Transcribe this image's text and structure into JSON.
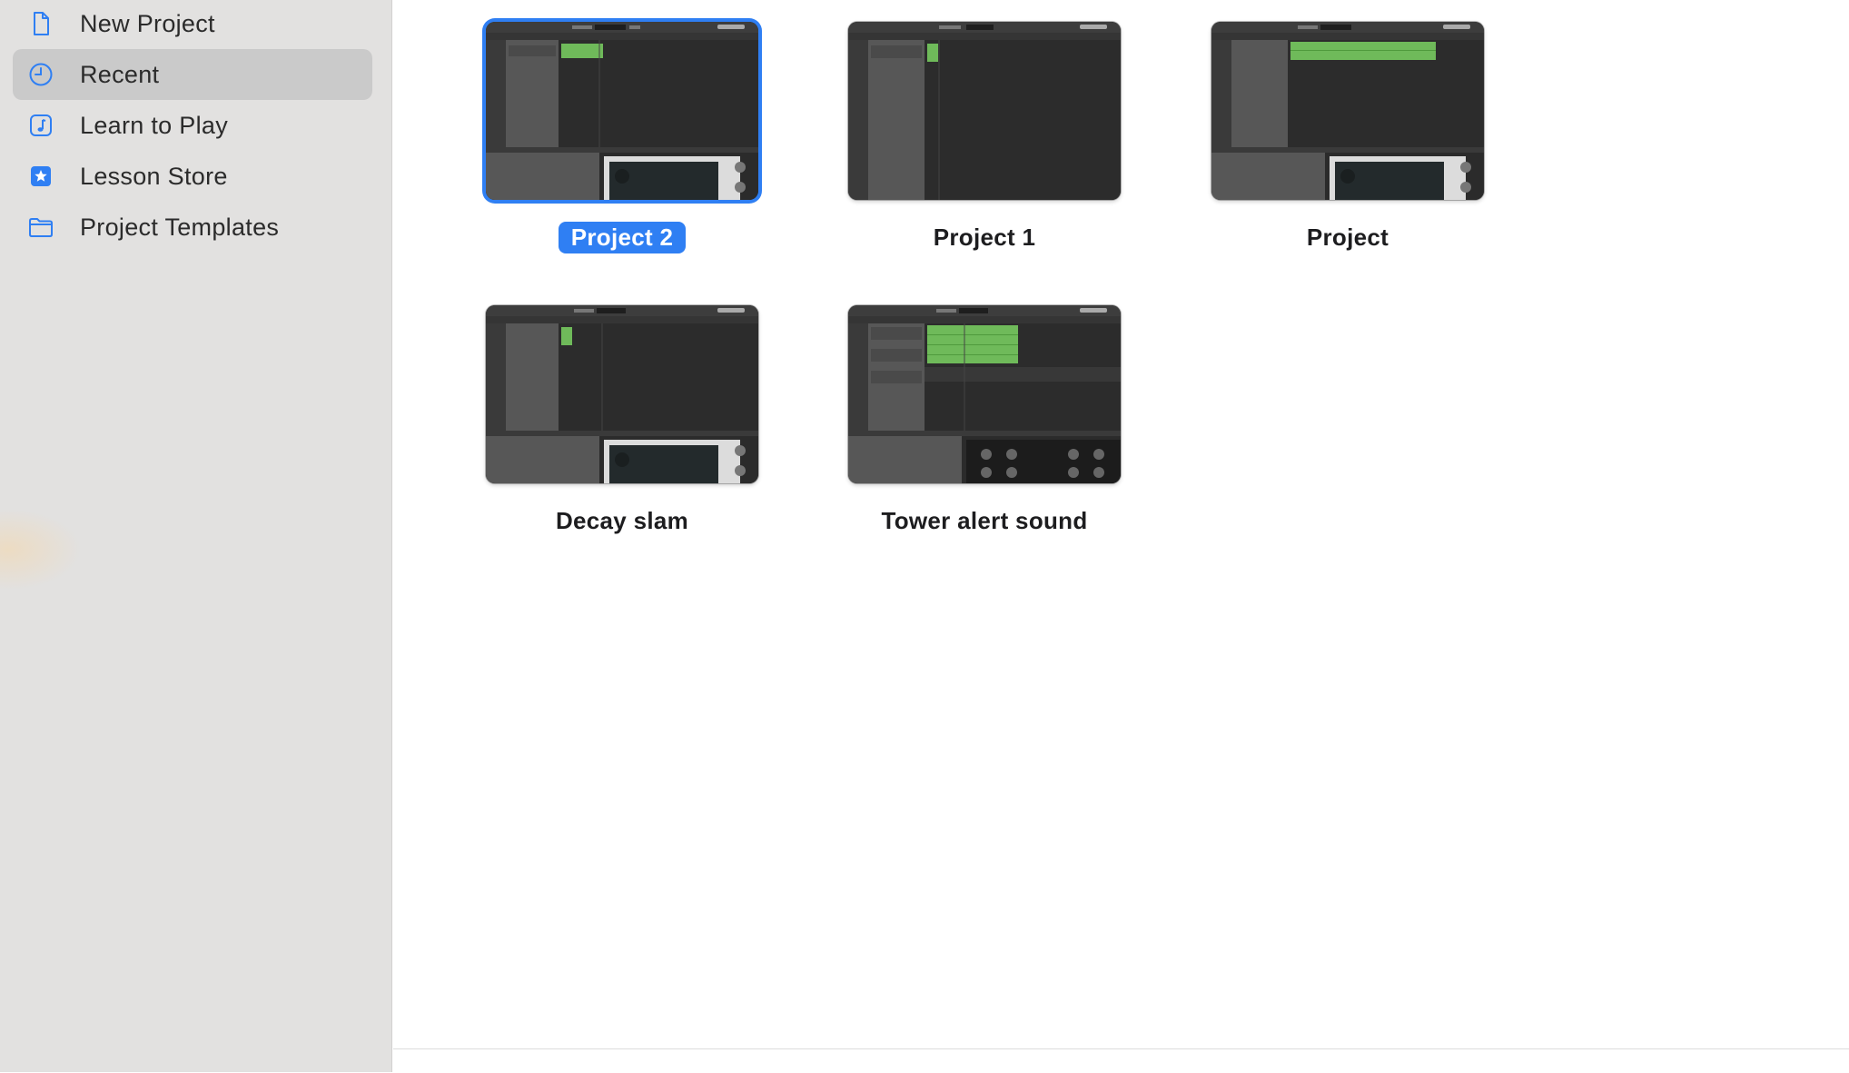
{
  "sidebar": {
    "items": [
      {
        "label": "New Project",
        "icon": "document-icon",
        "selected": false
      },
      {
        "label": "Recent",
        "icon": "clock-icon",
        "selected": true
      },
      {
        "label": "Learn to Play",
        "icon": "music-note-icon",
        "selected": false
      },
      {
        "label": "Lesson Store",
        "icon": "star-icon",
        "selected": false
      },
      {
        "label": "Project Templates",
        "icon": "folder-icon",
        "selected": false
      }
    ]
  },
  "projects": [
    {
      "name": "Project 2",
      "selected": true
    },
    {
      "name": "Project 1",
      "selected": false
    },
    {
      "name": "Project",
      "selected": false
    },
    {
      "name": "Decay slam",
      "selected": false
    },
    {
      "name": "Tower alert sound",
      "selected": false
    }
  ],
  "colors": {
    "accent": "#2f7ff3",
    "sidebar_bg": "#e2e1e0",
    "selected_row": "#cacaca",
    "region_green": "#6fba5a"
  }
}
